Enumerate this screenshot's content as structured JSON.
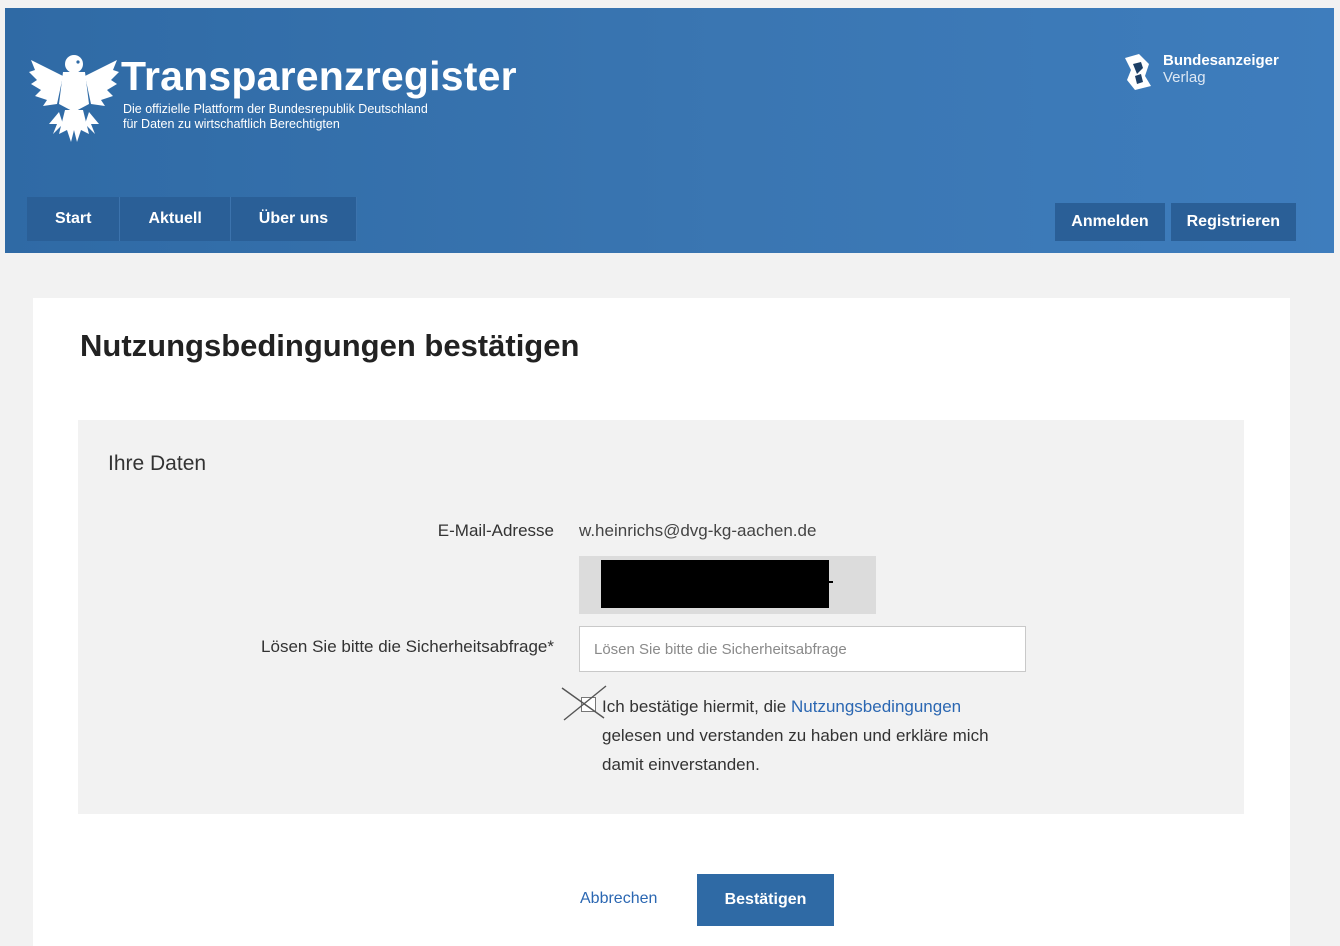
{
  "header": {
    "title": "Transparenzregister",
    "subtitle_line1": "Die offizielle Plattform der Bundesrepublik Deutschland",
    "subtitle_line2": "für Daten zu wirtschaftlich Berechtigten",
    "publisher_bold": "Bundesanzeiger",
    "publisher_normal": "Verlag",
    "logo_icon": "federal-eagle-icon",
    "publisher_icon": "bundesanzeiger-logo-icon"
  },
  "nav": {
    "items": [
      {
        "label": "Start"
      },
      {
        "label": "Aktuell"
      },
      {
        "label": "Über uns"
      }
    ],
    "login_label": "Anmelden",
    "register_label": "Registrieren"
  },
  "main": {
    "page_title": "Nutzungsbedingungen bestätigen",
    "section_title": "Ihre Daten",
    "email_label": "E-Mail-Adresse",
    "email_value": "w.heinrichs@dvg-kg-aachen.de",
    "captcha_label": "Lösen Sie bitte die Sicherheitsabfrage*",
    "captcha_placeholder": "Lösen Sie bitte die Sicherheitsabfrage",
    "consent_prefix": "Ich bestätige hiermit, die ",
    "consent_link": "Nutzungsbedingungen",
    "consent_suffix": " gelesen und verstanden zu haben und erkläre mich damit einverstanden.",
    "cancel_label": "Abbrechen",
    "confirm_label": "Bestätigen"
  },
  "colors": {
    "header_blue": "#3a76b2",
    "nav_blue": "#2a5f97",
    "link_blue": "#2b67b2",
    "button_blue": "#2f6aa5"
  }
}
